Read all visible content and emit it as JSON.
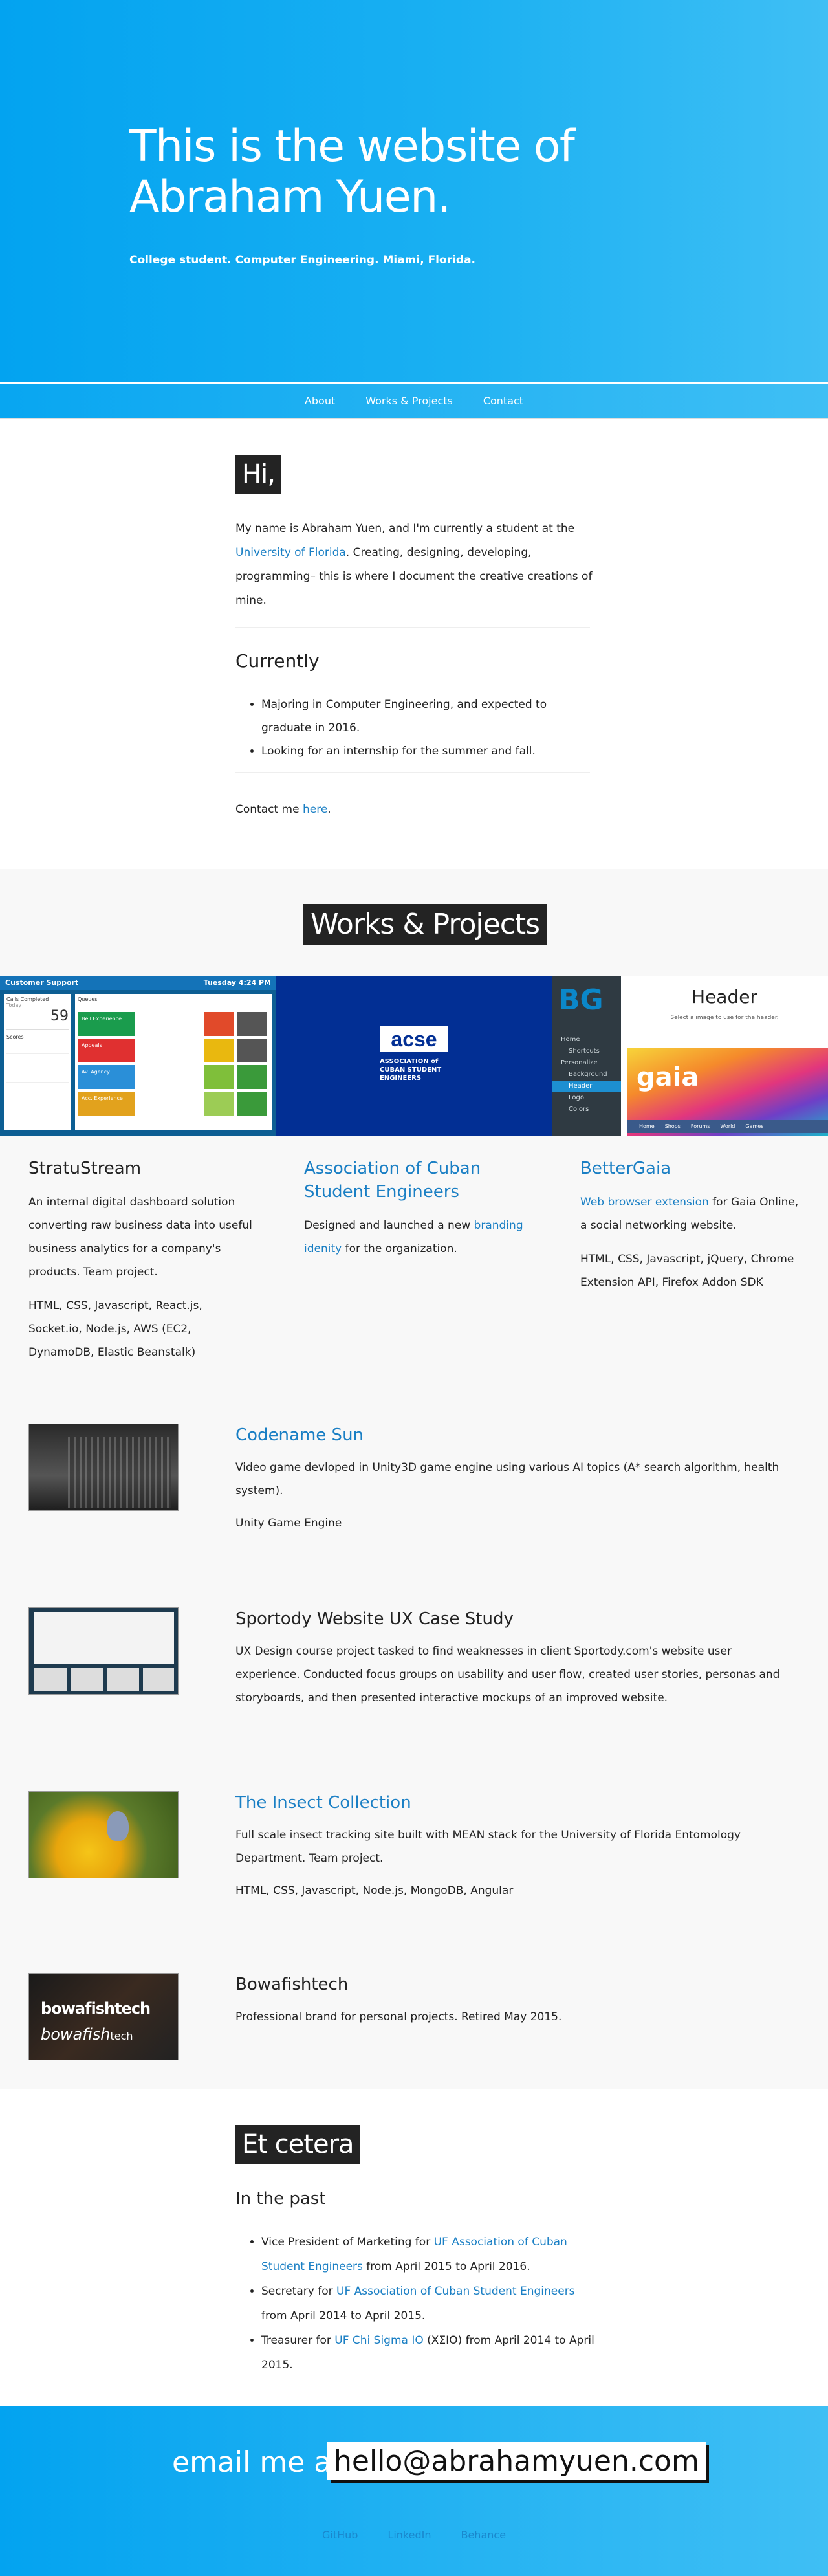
{
  "hero": {
    "title": "This is the website of Abraham Yuen.",
    "subtitle": "College student. Computer Engineering. Miami, Florida."
  },
  "nav": {
    "items": [
      "About",
      "Works & Projects",
      "Contact"
    ]
  },
  "intro": {
    "label": "Hi,",
    "para_pre": "My name is Abraham Yuen, and I'm currently a student at the ",
    "para_link": "University of Florida",
    "para_post": ". Creating, designing, developing, programming– this is where I document the creative creations of mine.",
    "currently_title": "Currently",
    "currently_items": [
      "Majoring in Computer Engineering, and expected to graduate in 2016.",
      "Looking for an internship for the summer and fall."
    ],
    "contact_pre": "Contact me ",
    "contact_link": "here",
    "contact_post": "."
  },
  "works": {
    "label": "Works & Projects",
    "dashboard": {
      "title": "Customer Support",
      "time": "Tuesday 4:24 PM",
      "calls_label": "Calls Completed",
      "calls_sub": "Today",
      "calls_value": "59",
      "queues_label": "Queues",
      "scores_label": "Scores",
      "rows": [
        {
          "label": "Bell Experience",
          "color": "#1a9c4d"
        },
        {
          "label": "Appeals",
          "color": "#e03030"
        },
        {
          "label": "Av. Agency",
          "color": "#2a8fd8"
        },
        {
          "label": "Acc. Experience",
          "color": "#e2a21d"
        }
      ]
    },
    "acse_logo": "acse",
    "acse_text": "ASSOCIATION of CUBAN STUDENT ENGINEERS",
    "gaia": {
      "logo": "BG",
      "header": "Header",
      "sub": "Select a image to use for the header.",
      "menu": [
        "Home",
        "Shortcuts",
        "Personalize",
        "Background",
        "Header",
        "Logo",
        "Colors"
      ],
      "brand": "gaia",
      "tabs": [
        "Home",
        "Shops",
        "Forums",
        "World",
        "Games"
      ]
    },
    "cards": [
      {
        "title": "StratuStream",
        "desc": "An internal digital dashboard solution converting raw business data into useful business analytics for a company's products. Team project.",
        "tech": "HTML, CSS, Javascript, React.js, Socket.io, Node.js, AWS (EC2, DynamoDB, Elastic Beanstalk)"
      },
      {
        "title": "Association of Cuban Student Engineers",
        "desc_pre": "Designed and launched a new ",
        "desc_link": "branding idenity",
        "desc_post": " for the organization."
      },
      {
        "title": "BetterGaia",
        "desc_link": "Web browser extension",
        "desc_post": " for Gaia Online, a social networking website.",
        "tech": "HTML, CSS, Javascript, jQuery, Chrome Extension API, Firefox Addon SDK"
      }
    ],
    "rows": [
      {
        "title": "Codename Sun",
        "desc": "Video game devloped in Unity3D game engine using various AI topics (A* search algorithm, health system).",
        "tech": "Unity Game Engine"
      },
      {
        "title": "Sportody Website UX Case Study",
        "desc": "UX Design course project tasked to find weaknesses in client Sportody.com's website user experience. Conducted focus groups on usability and user flow, created user stories, personas and storyboards, and then presented interactive mockups of an improved website."
      },
      {
        "title": "The Insect Collection",
        "desc": "Full scale insect tracking site built with MEAN stack for the University of Florida Entomology Department. Team project.",
        "tech": "HTML, CSS, Javascript, Node.js, MongoDB, Angular"
      },
      {
        "title": "Bowafishtech",
        "desc": "Professional brand for personal projects. Retired May 2015.",
        "logo_top": "bowafishtech",
        "logo_bottom_a": "bowafish",
        "logo_bottom_b": "tech"
      }
    ]
  },
  "etc": {
    "label": "Et cetera",
    "past_title": "In the past",
    "items": [
      {
        "pre": "Vice President of Marketing for ",
        "link": "UF Association of Cuban Student Engineers",
        "post": " from April 2015 to April 2016."
      },
      {
        "pre": "Secretary for ",
        "link": "UF Association of Cuban Student Engineers",
        "post": " from April 2014 to April 2015."
      },
      {
        "pre": "Treasurer for ",
        "link": "UF Chi Sigma IO",
        "post": " (ΧΣΙΟ) from April 2014 to April 2015."
      }
    ]
  },
  "footer": {
    "email_label": "email me at",
    "email": "hello@abrahamyuen.com",
    "links": [
      "GitHub",
      "LinkedIn",
      "Behance"
    ]
  },
  "colors": {
    "accent": "#03a3f0",
    "link": "#1a7fc4",
    "dark": "#232323"
  }
}
